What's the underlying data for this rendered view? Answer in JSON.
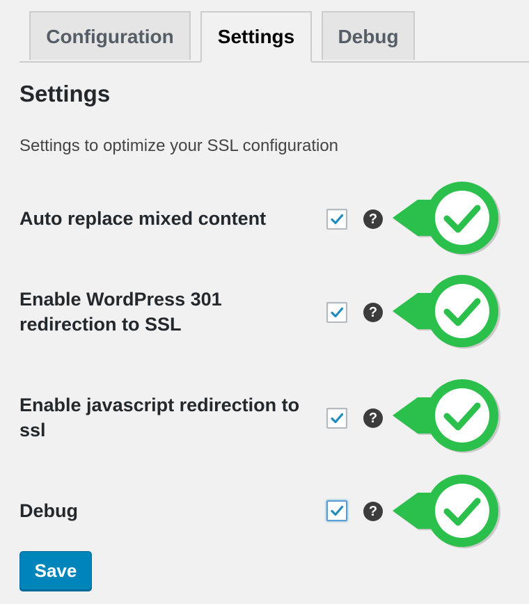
{
  "tabs": [
    {
      "label": "Configuration",
      "active": false
    },
    {
      "label": "Settings",
      "active": true
    },
    {
      "label": "Debug",
      "active": false
    }
  ],
  "page": {
    "title": "Settings",
    "description": "Settings to optimize your SSL configuration"
  },
  "settings": [
    {
      "label": "Auto replace mixed content",
      "checked": true,
      "help_icon": "help-icon",
      "status": "ok",
      "status_icon": "green-check-icon"
    },
    {
      "label": "Enable WordPress 301 redirection to SSL",
      "checked": true,
      "help_icon": "help-icon",
      "status": "ok",
      "status_icon": "green-check-icon"
    },
    {
      "label": "Enable javascript redirection to ssl",
      "checked": true,
      "help_icon": "help-icon",
      "status": "ok",
      "status_icon": "green-check-icon"
    },
    {
      "label": "Debug",
      "checked": true,
      "help_icon": "help-icon",
      "status": "ok",
      "status_icon": "green-check-icon"
    }
  ],
  "help_glyph": "?",
  "save_label": "Save",
  "colors": {
    "accent": "#0085ba",
    "check_blue": "#1e8cbe",
    "status_green": "#2bbf4b",
    "help_dark": "#3c3c3c"
  }
}
